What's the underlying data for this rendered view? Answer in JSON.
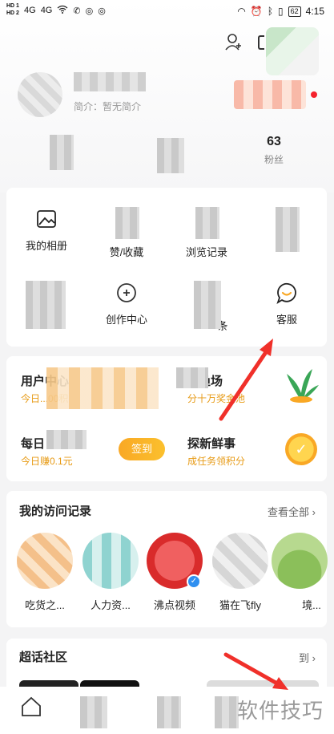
{
  "status_bar": {
    "hd_top": "HD 1",
    "hd_bottom": "HD 2",
    "network": "4G",
    "network2": "4G",
    "battery": "62",
    "time": "4:15"
  },
  "profile": {
    "bio": "简介：暂无简介"
  },
  "stats": [
    {
      "num": "",
      "label": ""
    },
    {
      "num": "",
      "label": ""
    },
    {
      "num": "63",
      "label": "粉丝"
    }
  ],
  "quick_grid": [
    {
      "label": "我的相册",
      "icon": "photo-album-icon"
    },
    {
      "label": "赞/收藏",
      "icon": "like-favorite-icon"
    },
    {
      "label": "浏览记录",
      "icon": "history-icon"
    },
    {
      "label": "",
      "icon": "blurred-icon"
    },
    {
      "label": "",
      "icon": "blurred-icon"
    },
    {
      "label": "创作中心",
      "icon": "creator-center-icon"
    },
    {
      "label": "条",
      "icon": "blurred-icon"
    },
    {
      "label": "客服",
      "icon": "customer-service-icon"
    }
  ],
  "promo": {
    "user_center_title": "用户中心",
    "user_center_sub": "今日...00积",
    "arena_title": "渔场",
    "arena_sub": "分十万奖金池",
    "daily_title": "每日",
    "daily_sub": "今日赚0.1元",
    "sign_in": "签到",
    "fresh_title": "探新鲜事",
    "fresh_sub": "成任务领积分"
  },
  "visits": {
    "title": "我的访问记录",
    "see_all": "查看全部",
    "items": [
      {
        "label": "吃货之..."
      },
      {
        "label": "人力资..."
      },
      {
        "label": "沸点视频"
      },
      {
        "label": "猫在飞fly"
      },
      {
        "label": "境..."
      }
    ]
  },
  "super_topic": {
    "title": "超话社区",
    "action": "到"
  },
  "watermark": "软件技巧",
  "colors": {
    "accent_orange": "#f9a825",
    "arrow_red": "#f0302a",
    "verified_blue": "#2f8ff0"
  }
}
